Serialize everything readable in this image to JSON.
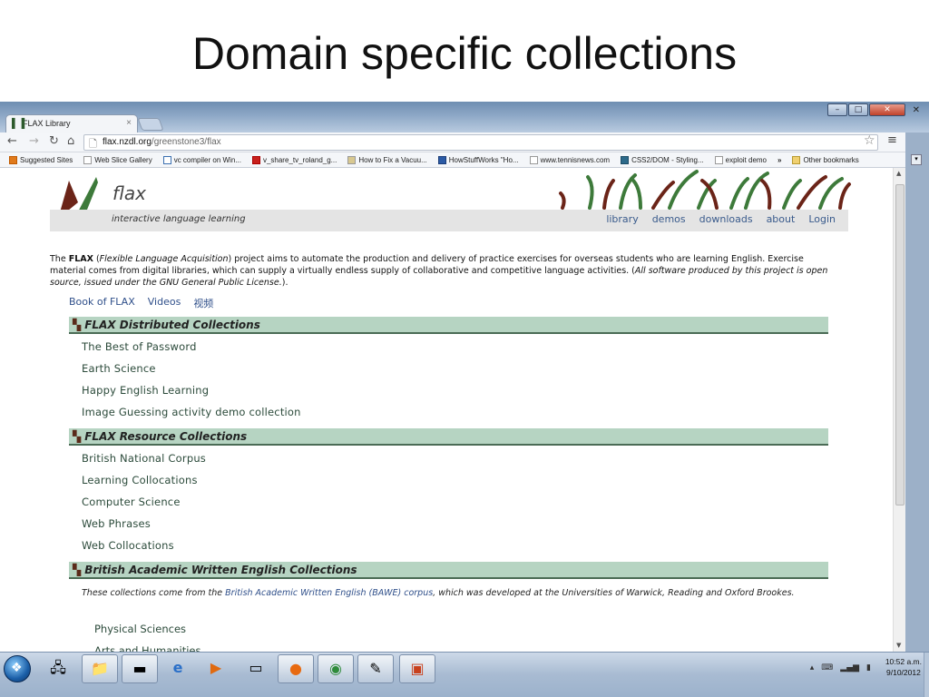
{
  "slide": {
    "title": "Domain specific collections"
  },
  "browser": {
    "tab_title": "FLAX Library",
    "tab_close": "×",
    "url_domain": "flax.nzdl.org",
    "url_path": "/greenstone3/flax",
    "bookmarks": [
      "Suggested Sites",
      "Web Slice Gallery",
      "vc compiler on Win...",
      "v_share_tv_roland_g...",
      "How to Fix a Vacuu...",
      "HowStuffWorks \"Ho...",
      "www.tennisnews.com",
      "CSS2/DOM - Styling...",
      "exploit demo",
      "»",
      "Other bookmarks"
    ]
  },
  "page": {
    "logo_text": "flax",
    "tagline": "interactive language learning",
    "nav": [
      "library",
      "demos",
      "downloads",
      "about",
      "Login"
    ],
    "intro": {
      "the": "The ",
      "flax": "FLAX",
      "paren_open": " (",
      "flax_full": "Flexible Language Acquisition",
      "body": ") project aims to automate the production and delivery of practice exercises for overseas students who are learning English. Exercise material comes from digital libraries, which can supply a virtually endless supply of collaborative and competitive language activities. (",
      "license": "All software produced by this project is open source, issued under the GNU General Public License.",
      "end": ")."
    },
    "links": [
      "Book of FLAX",
      "Videos",
      "视频"
    ],
    "sections": [
      {
        "title": "FLAX Distributed Collections",
        "items": [
          "The Best of Password",
          "Earth Science",
          "Happy English Learning",
          "Image Guessing activity demo collection"
        ]
      },
      {
        "title": "FLAX Resource Collections",
        "items": [
          "British National Corpus",
          "Learning Collocations",
          "Computer Science",
          "Web Phrases",
          "Web Collocations"
        ]
      },
      {
        "title": "British Academic Written English Collections",
        "intro_before": "These collections come from the ",
        "intro_link": "British Academic Written English (BAWE) corpus",
        "intro_after": ", which was developed at the Universities of Warwick, Reading and Oxford Brookes.",
        "items": [
          "Physical Sciences",
          "Arts and Humanities"
        ]
      }
    ]
  },
  "taskbar": {
    "time": "10:52 a.m.",
    "date": "9/10/2012"
  }
}
